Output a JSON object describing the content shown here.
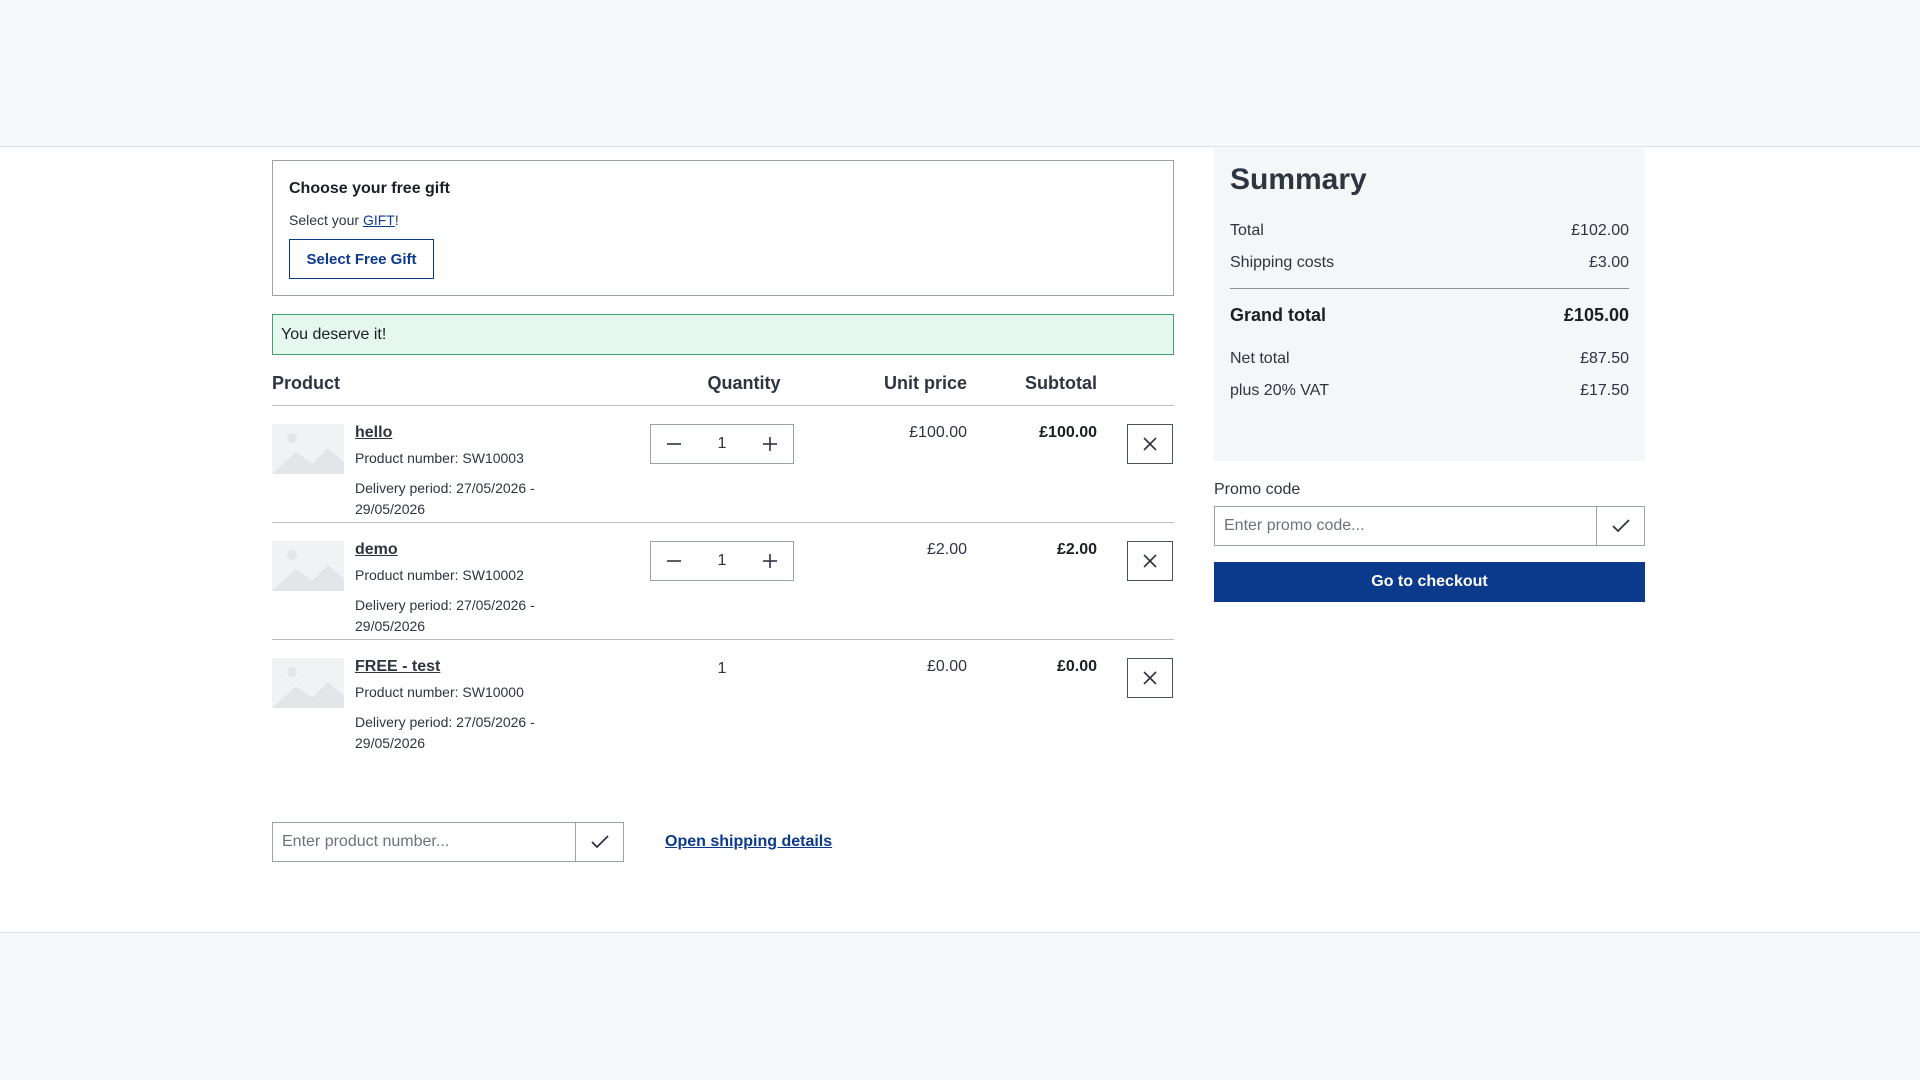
{
  "colors": {
    "primary": "#0b3a8c",
    "success_bg": "#e5f7ef",
    "success_border": "#3fa26b",
    "summary_bg": "#f5f6f7"
  },
  "gift": {
    "title": "Choose your free gift",
    "subtitle_prefix": "Select your ",
    "subtitle_link": "GIFT",
    "subtitle_suffix": "!",
    "button_label": "Select Free Gift"
  },
  "alert": {
    "text": "You deserve it!"
  },
  "cart": {
    "headers": {
      "product": "Product",
      "quantity": "Quantity",
      "unit_price": "Unit price",
      "subtotal": "Subtotal"
    },
    "items": [
      {
        "name": "hello",
        "product_number": "Product number: SW10003",
        "delivery": "Delivery period: 27/05/2026 - 29/05/2026",
        "quantity": "1",
        "unit_price": "£100.00",
        "subtotal": "£100.00",
        "icons": {
          "minus": "minus-icon",
          "plus": "plus-icon",
          "remove": "close-icon"
        }
      },
      {
        "name": "demo",
        "product_number": "Product number: SW10002",
        "delivery": "Delivery period: 27/05/2026 - 29/05/2026",
        "quantity": "1",
        "unit_price": "£2.00",
        "subtotal": "£2.00",
        "icons": {
          "minus": "minus-icon",
          "plus": "plus-icon",
          "remove": "close-icon"
        }
      },
      {
        "name": "FREE - test",
        "product_number": "Product number: SW10000",
        "delivery": "Delivery period: 27/05/2026 - 29/05/2026",
        "quantity": "1",
        "unit_price": "£0.00",
        "subtotal": "£0.00",
        "icons": {
          "remove": "close-icon"
        }
      }
    ]
  },
  "product_number_input": {
    "placeholder": "Enter product number...",
    "submit_icon": "checkmark-icon"
  },
  "shipping_link": "Open shipping details",
  "summary": {
    "title": "Summary",
    "total_label": "Total",
    "total_value": "£102.00",
    "shipping_label": "Shipping costs",
    "shipping_value": "£3.00",
    "grand_total_label": "Grand total",
    "grand_total_value": "£105.00",
    "net_total_label": "Net total",
    "net_total_value": "£87.50",
    "vat_label": "plus 20% VAT",
    "vat_value": "£17.50"
  },
  "promo": {
    "label": "Promo code",
    "placeholder": "Enter promo code...",
    "submit_icon": "checkmark-icon"
  },
  "checkout": {
    "label": "Go to checkout"
  }
}
